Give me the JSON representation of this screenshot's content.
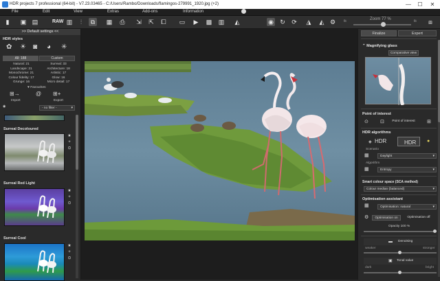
{
  "window": {
    "title": "HDR projects 7 professional (64-bit) - V7.23.03465 - C:/Users/Rambo/Downloads/flamingos-279991_1920.jpg (+2)",
    "controls": [
      "—",
      "☐",
      "✕"
    ]
  },
  "menu": [
    "File",
    "Edit",
    "View",
    "Extras",
    "Add-ons",
    "Information"
  ],
  "toolbar": {
    "raw_label": "RAW",
    "zoom_label": "Zoom",
    "zoom_value": "77",
    "zoom_unit": "%",
    "zoom_min": "fit",
    "zoom_max": "fit"
  },
  "left": {
    "default_settings": ">> Default settings <<",
    "hdr_styles": "HDR styles",
    "tab_all": "All: 188",
    "tab_custom": "Custom",
    "counts": [
      [
        "Natural: 21",
        "Surreal: 33"
      ],
      [
        "Landscape: 21",
        "Architecture: 18"
      ],
      [
        "Monochrome: 21",
        "Artistic: 17"
      ],
      [
        "Colour fidelity: 17",
        "Glow: 16"
      ],
      [
        "Grunge: 16",
        "Micro detail: 17"
      ]
    ],
    "favourites": "Favourites",
    "import": "Import",
    "export": "Export",
    "filter": "- no filter -",
    "presets": [
      {
        "name": "Surreal Decoloured"
      },
      {
        "name": "Surreal Red Light"
      },
      {
        "name": "Surreal Cool"
      }
    ]
  },
  "right": {
    "tab_finalize": "Finalize",
    "tab_expert": "Expert",
    "magnifying_glass": "Magnifying glass",
    "comparative_view": "Comparative view",
    "point_of_interest": "Point of interest",
    "point_of_interest_btn": "Point of interest",
    "hdr_algorithms": "HDR algorithms",
    "hdr_btn": "HDR",
    "hdr_ultra": "HDR",
    "scenario_label": "Scenario",
    "scenario_value": "Daylight",
    "algorithm_label": "Algorithm",
    "algorithm_value": "Entropy",
    "smart_colour": "Smart colour space (SCA method)",
    "smart_colour_value": "Colour median (balanced)",
    "optimisation": "Optimisation assistant",
    "optimisation_value": "Optimisation: natural",
    "optimisation_on": "Optimisation on",
    "optimisation_off": "Optimisation off",
    "opacity_label": "Opacity",
    "opacity_value": "100",
    "opacity_unit": "%",
    "opacity_level": 1.0,
    "denoising": "Denoising",
    "weaker": "weaker",
    "stronger": "stronger",
    "tonal_value": "Tonal value",
    "dark": "dark",
    "bright": "bright"
  }
}
